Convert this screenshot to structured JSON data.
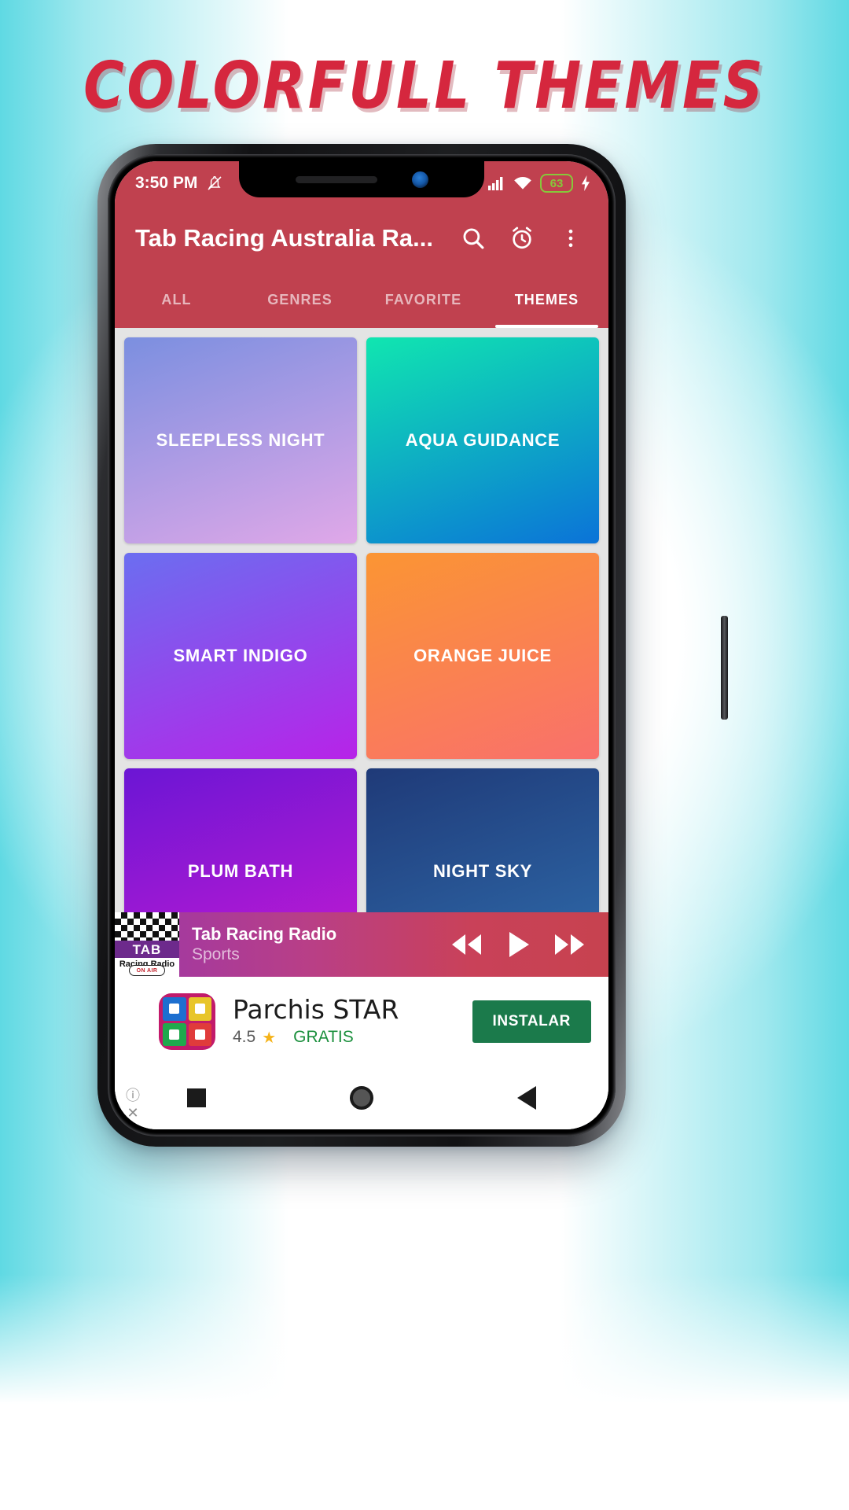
{
  "headline": "COLORFULL THEMES",
  "brand": {
    "accent": "#c0414f",
    "headline_color": "#d5273e",
    "bg_cyan": "#5fd9e3"
  },
  "status_bar": {
    "time": "3:50 PM",
    "notifications_silenced_icon": "bell-muted-icon",
    "signal_icon": "signal-bars-icon",
    "wifi_icon": "wifi-icon",
    "battery_level": "63",
    "charging_icon": "charging-bolt-icon"
  },
  "app_bar": {
    "title": "Tab Racing Australia Ra...",
    "search_icon": "search-icon",
    "alarm_icon": "alarm-clock-icon",
    "overflow_icon": "more-vertical-icon"
  },
  "tabs": [
    {
      "label": "ALL",
      "active": false
    },
    {
      "label": "GENRES",
      "active": false
    },
    {
      "label": "FAVORITE",
      "active": false
    },
    {
      "label": "THEMES",
      "active": true
    }
  ],
  "themes": [
    {
      "name": "SLEEPLESS NIGHT",
      "from": "#7b8fe0",
      "to": "#e0a8e8"
    },
    {
      "name": "AQUA GUIDANCE",
      "from": "#10e6b0",
      "to": "#0b73d8"
    },
    {
      "name": "SMART INDIGO",
      "from": "#6b6ef0",
      "to": "#b723e8"
    },
    {
      "name": "ORANGE JUICE",
      "from": "#fb9533",
      "to": "#f9706c"
    },
    {
      "name": "PLUM BATH",
      "from": "#6b16d4",
      "to": "#c41ad2"
    },
    {
      "name": "NIGHT SKY",
      "from": "#1f3a78",
      "to": "#2f6bab"
    }
  ],
  "player": {
    "station": "Tab Racing Radio",
    "genre": "Sports",
    "artwork_label": "TAB",
    "artwork_sub": "Racing Radio",
    "artwork_badge": "ON AIR",
    "prev_icon": "rewind-icon",
    "play_icon": "play-icon",
    "next_icon": "fast-forward-icon"
  },
  "ad": {
    "title": "Parchis STAR",
    "rating": "4.5",
    "star_icon": "star-icon",
    "price": "GRATIS",
    "cta": "INSTALAR",
    "info_icon": "info-icon",
    "close_icon": "close-icon"
  },
  "nav_bar": {
    "recents_icon": "square-icon",
    "home_icon": "circle-icon",
    "back_icon": "triangle-back-icon"
  }
}
